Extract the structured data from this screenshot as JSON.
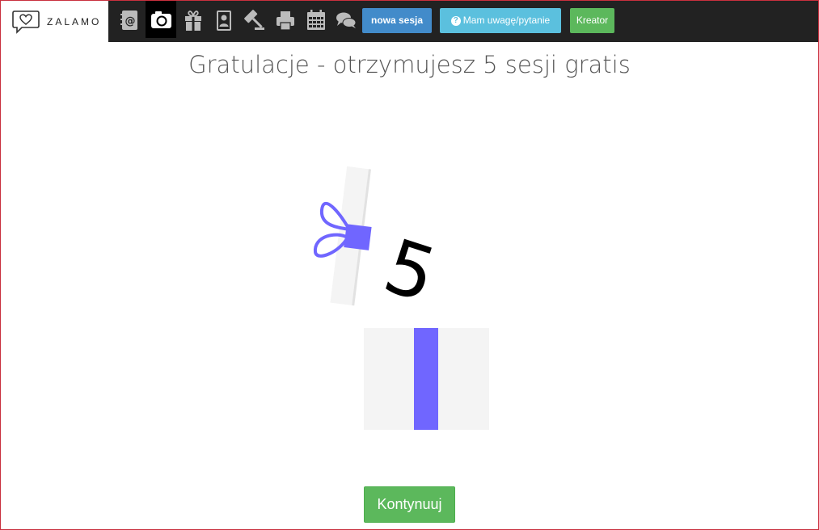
{
  "header": {
    "logo_text": "ZALAMO",
    "nav_icons": [
      {
        "name": "address-book-icon"
      },
      {
        "name": "camera-icon",
        "active": true
      },
      {
        "name": "gift-icon"
      },
      {
        "name": "contact-card-icon"
      },
      {
        "name": "gavel-icon"
      },
      {
        "name": "printer-icon"
      },
      {
        "name": "calendar-icon"
      },
      {
        "name": "chat-icon"
      }
    ],
    "new_session_label": "nowa sesja",
    "question_label": "Mam uwagę/pytanie",
    "question_icon": "?",
    "creator_label": "Kreator"
  },
  "main": {
    "title": "Gratulacje - otrzymujesz 5 sesji gratis",
    "gift_number": "5",
    "continue_label": "Kontynuuj"
  },
  "colors": {
    "topbar": "#222222",
    "ribbon": "#7066ff",
    "gift_paper": "#f4f4f4",
    "btn_primary": "#428bca",
    "btn_info": "#5bc0de",
    "btn_success": "#5cb85c"
  }
}
